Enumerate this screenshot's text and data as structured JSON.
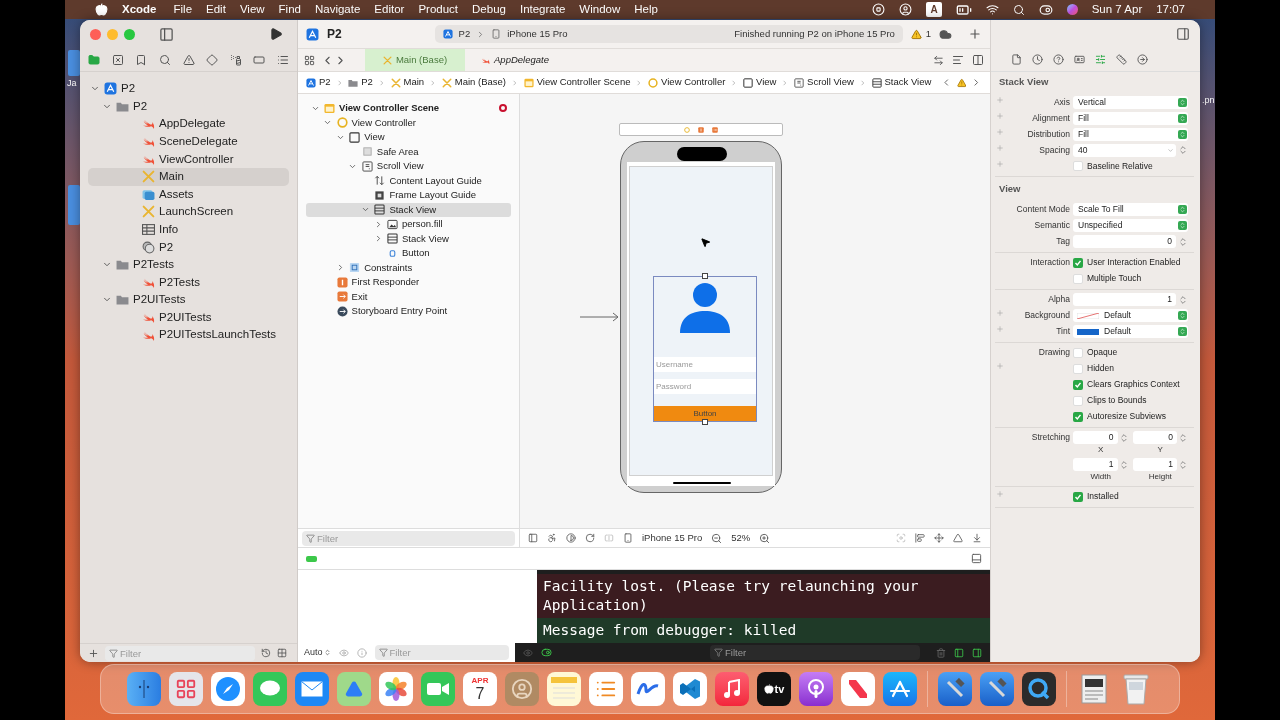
{
  "menu_bar": {
    "app": "Xcode",
    "menus": [
      "File",
      "Edit",
      "View",
      "Find",
      "Navigate",
      "Editor",
      "Product",
      "Debug",
      "Integrate",
      "Window",
      "Help"
    ],
    "input_source": "A",
    "date": "Sun 7 Apr",
    "time": "17:07"
  },
  "desktop": {
    "labels": [
      "Ja",
      ".pn"
    ]
  },
  "window": {
    "title": "P2",
    "scheme": [
      "P2",
      "iPhone 15 Pro"
    ],
    "status": "Finished running P2 on iPhone 15 Pro",
    "warning_count": "1"
  },
  "editor_tabs": [
    {
      "label": "Main (Base)",
      "kind": "storyboard",
      "selected": true
    },
    {
      "label": "AppDelegate",
      "kind": "swift",
      "selected": false
    }
  ],
  "navigator": {
    "filter_placeholder": "Filter",
    "items": [
      {
        "label": "P2",
        "kind": "project",
        "expanded": true,
        "selected": false,
        "children": [
          {
            "label": "P2",
            "kind": "folder",
            "expanded": true,
            "selected": false,
            "children": [
              {
                "label": "AppDelegate",
                "kind": "swift",
                "selected": false
              },
              {
                "label": "SceneDelegate",
                "kind": "swift",
                "selected": false
              },
              {
                "label": "ViewController",
                "kind": "swift",
                "selected": false
              },
              {
                "label": "Main",
                "kind": "storyboard",
                "selected": true
              },
              {
                "label": "Assets",
                "kind": "assets",
                "selected": false
              },
              {
                "label": "LaunchScreen",
                "kind": "storyboard",
                "selected": false
              },
              {
                "label": "Info",
                "kind": "plist",
                "selected": false
              },
              {
                "label": "P2",
                "kind": "entitlements",
                "selected": false
              }
            ]
          },
          {
            "label": "P2Tests",
            "kind": "folder",
            "expanded": true,
            "selected": false,
            "children": [
              {
                "label": "P2Tests",
                "kind": "swift",
                "selected": false
              }
            ]
          },
          {
            "label": "P2UITests",
            "kind": "folder",
            "expanded": true,
            "selected": false,
            "children": [
              {
                "label": "P2UITests",
                "kind": "swift",
                "selected": false
              },
              {
                "label": "P2UITestsLaunchTests",
                "kind": "swift",
                "selected": false
              }
            ]
          }
        ]
      }
    ]
  },
  "breadcrumb": [
    {
      "label": "P2",
      "kind": "project"
    },
    {
      "label": "P2",
      "kind": "folder"
    },
    {
      "label": "Main",
      "kind": "storyboard"
    },
    {
      "label": "Main (Base)",
      "kind": "storyboard"
    },
    {
      "label": "View Controller Scene",
      "kind": "scene"
    },
    {
      "label": "View Controller",
      "kind": "controller"
    },
    {
      "label": "View",
      "kind": "view"
    },
    {
      "label": "Scroll View",
      "kind": "scroll_view"
    },
    {
      "label": "Stack View",
      "kind": "stack_view"
    }
  ],
  "outline": {
    "filter_placeholder": "Filter",
    "items": [
      {
        "label": "View Controller Scene",
        "kind": "scene",
        "issue": true,
        "expanded": true,
        "selected": false,
        "children": [
          {
            "label": "View Controller",
            "kind": "controller",
            "expanded": true,
            "selected": false,
            "children": [
              {
                "label": "View",
                "kind": "view",
                "expanded": true,
                "selected": false,
                "children": [
                  {
                    "label": "Safe Area",
                    "kind": "safe_area",
                    "selected": false
                  },
                  {
                    "label": "Scroll View",
                    "kind": "scroll_view",
                    "expanded": true,
                    "selected": false,
                    "children": [
                      {
                        "label": "Content Layout Guide",
                        "kind": "content_guide",
                        "selected": false
                      },
                      {
                        "label": "Frame Layout Guide",
                        "kind": "frame_guide",
                        "selected": false
                      },
                      {
                        "label": "Stack View",
                        "kind": "stack_view",
                        "expanded": true,
                        "selected": true,
                        "children": [
                          {
                            "label": "person.fill",
                            "kind": "image_view",
                            "expanded": false,
                            "selected": false
                          },
                          {
                            "label": "Stack View",
                            "kind": "stack_view",
                            "expanded": false,
                            "selected": false
                          },
                          {
                            "label": "Button",
                            "kind": "button",
                            "selected": false
                          }
                        ]
                      }
                    ]
                  }
                ]
              },
              {
                "label": "Constraints",
                "kind": "constraints",
                "expanded": false,
                "selected": false
              }
            ]
          },
          {
            "label": "First Responder",
            "kind": "responder",
            "selected": false
          },
          {
            "label": "Exit",
            "kind": "exit",
            "selected": false
          },
          {
            "label": "Storyboard Entry Point",
            "kind": "entry",
            "selected": false
          }
        ]
      }
    ]
  },
  "canvas": {
    "username_placeholder": "Username",
    "password_placeholder": "Password",
    "button": "Button",
    "device": "iPhone 15 Pro",
    "zoom": "52%"
  },
  "debug": {
    "variables_mode": "Auto",
    "variables_filter_placeholder": "Filter",
    "console_filter_placeholder": "Filter",
    "lines": [
      {
        "text": "Facility lost. (Please try relaunching your Application)",
        "kind": "error"
      },
      {
        "text": "Message from debugger: killed",
        "kind": "info"
      }
    ]
  },
  "inspector": {
    "sections": [
      {
        "title": "Stack View",
        "groups": [
          [
            {
              "kind": "popup",
              "label": "Axis",
              "value": "Vertical",
              "plus": true
            },
            {
              "kind": "popup",
              "label": "Alignment",
              "value": "Fill",
              "plus": true
            },
            {
              "kind": "popup",
              "label": "Distribution",
              "value": "Fill",
              "plus": true
            },
            {
              "kind": "combo",
              "label": "Spacing",
              "value": "40",
              "plus": true
            },
            {
              "kind": "checkbox",
              "text": "Baseline Relative",
              "checked": false,
              "plus": true
            }
          ]
        ]
      },
      {
        "title": "View",
        "groups": [
          [
            {
              "kind": "popup",
              "label": "Content Mode",
              "value": "Scale To Fill",
              "plus": false
            },
            {
              "kind": "popup",
              "label": "Semantic",
              "value": "Unspecified",
              "plus": false
            },
            {
              "kind": "number",
              "label": "Tag",
              "value": "0",
              "plus": false
            }
          ],
          [
            {
              "kind": "checkbox",
              "label": "Interaction",
              "text": "User Interaction Enabled",
              "checked": true,
              "plus": false
            },
            {
              "kind": "checkbox",
              "text": "Multiple Touch",
              "checked": false,
              "plus": false
            }
          ],
          [
            {
              "kind": "number",
              "label": "Alpha",
              "value": "1",
              "plus": false
            },
            {
              "kind": "color",
              "label": "Background",
              "value": "Default",
              "plus": true
            },
            {
              "kind": "color",
              "label": "Tint",
              "value": "Default",
              "color": "#1565c8",
              "plus": true
            }
          ],
          [
            {
              "kind": "checkbox",
              "label": "Drawing",
              "text": "Opaque",
              "checked": false,
              "plus": false
            },
            {
              "kind": "checkbox",
              "text": "Hidden",
              "checked": false,
              "plus": true
            },
            {
              "kind": "checkbox",
              "text": "Clears Graphics Context",
              "checked": true,
              "plus": false
            },
            {
              "kind": "checkbox",
              "text": "Clips to Bounds",
              "checked": false,
              "plus": false
            },
            {
              "kind": "checkbox",
              "text": "Autoresize Subviews",
              "checked": true,
              "plus": false
            }
          ],
          [
            {
              "kind": "pair",
              "label": "Stretching",
              "fields": [
                {
                  "value": "0",
                  "caption": "X"
                },
                {
                  "value": "0",
                  "caption": "Y"
                }
              ],
              "plus": false
            },
            {
              "kind": "pair",
              "fields": [
                {
                  "value": "1",
                  "caption": "Width"
                },
                {
                  "value": "1",
                  "caption": "Height"
                }
              ],
              "plus": false
            }
          ],
          [
            {
              "kind": "checkbox",
              "text": "Installed",
              "checked": true,
              "plus": true
            }
          ]
        ]
      }
    ]
  },
  "dock": [
    {
      "kind": "finder"
    },
    {
      "kind": "launchpad"
    },
    {
      "kind": "safari"
    },
    {
      "kind": "messages"
    },
    {
      "kind": "mail"
    },
    {
      "kind": "maps"
    },
    {
      "kind": "photos"
    },
    {
      "kind": "facetime"
    },
    {
      "kind": "calendar",
      "month": "APR",
      "day": "7"
    },
    {
      "kind": "contacts"
    },
    {
      "kind": "notes"
    },
    {
      "kind": "reminders"
    },
    {
      "kind": "freeform"
    },
    {
      "kind": "vscode"
    },
    {
      "kind": "music"
    },
    {
      "kind": "tv",
      "label": "tv"
    },
    {
      "kind": "podcasts"
    },
    {
      "kind": "news"
    },
    {
      "kind": "appstore"
    },
    {
      "kind": "separator"
    },
    {
      "kind": "xcode"
    },
    {
      "kind": "xcode"
    },
    {
      "kind": "quicktime"
    },
    {
      "kind": "separator"
    },
    {
      "kind": "document"
    },
    {
      "kind": "trash"
    }
  ]
}
